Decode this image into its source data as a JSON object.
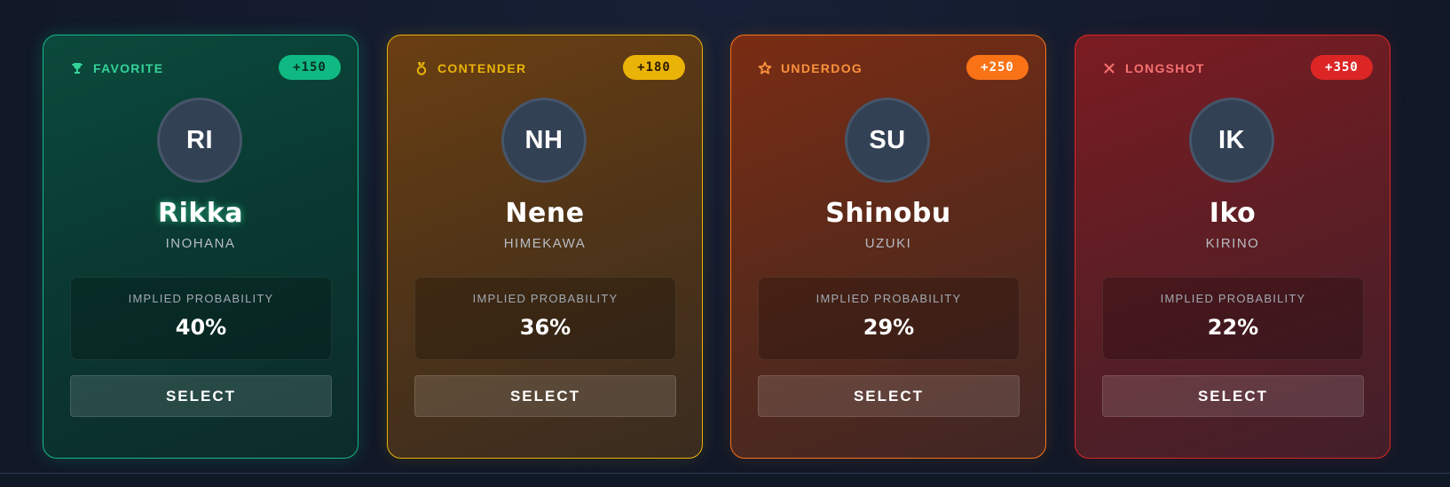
{
  "cards": [
    {
      "tier": "FAVORITE",
      "tier_icon": "trophy-icon",
      "odds": "+150",
      "initials": "RI",
      "first_name": "Rikka",
      "last_name": "INOHANA",
      "prob_label": "IMPLIED PROBABILITY",
      "probability": "40%",
      "select_label": "SELECT",
      "accent": "#10b981"
    },
    {
      "tier": "CONTENDER",
      "tier_icon": "medal-icon",
      "odds": "+180",
      "initials": "NH",
      "first_name": "Nene",
      "last_name": "HIMEKAWA",
      "prob_label": "IMPLIED PROBABILITY",
      "probability": "36%",
      "select_label": "SELECT",
      "accent": "#eab308"
    },
    {
      "tier": "UNDERDOG",
      "tier_icon": "star-icon",
      "odds": "+250",
      "initials": "SU",
      "first_name": "Shinobu",
      "last_name": "UZUKI",
      "prob_label": "IMPLIED PROBABILITY",
      "probability": "29%",
      "select_label": "SELECT",
      "accent": "#f97316"
    },
    {
      "tier": "LONGSHOT",
      "tier_icon": "close-icon",
      "odds": "+350",
      "initials": "IK",
      "first_name": "Iko",
      "last_name": "KIRINO",
      "prob_label": "IMPLIED PROBABILITY",
      "probability": "22%",
      "select_label": "SELECT",
      "accent": "#dc2626"
    }
  ],
  "colors": {
    "tier_text": [
      "#34d399",
      "#eab308",
      "#fb923c",
      "#f87171"
    ],
    "odds_bg": [
      "#10b981",
      "#eab308",
      "#f97316",
      "#dc2626"
    ],
    "odds_text": [
      "#052e22",
      "#2a1a02",
      "#ffffff",
      "#ffffff"
    ]
  }
}
